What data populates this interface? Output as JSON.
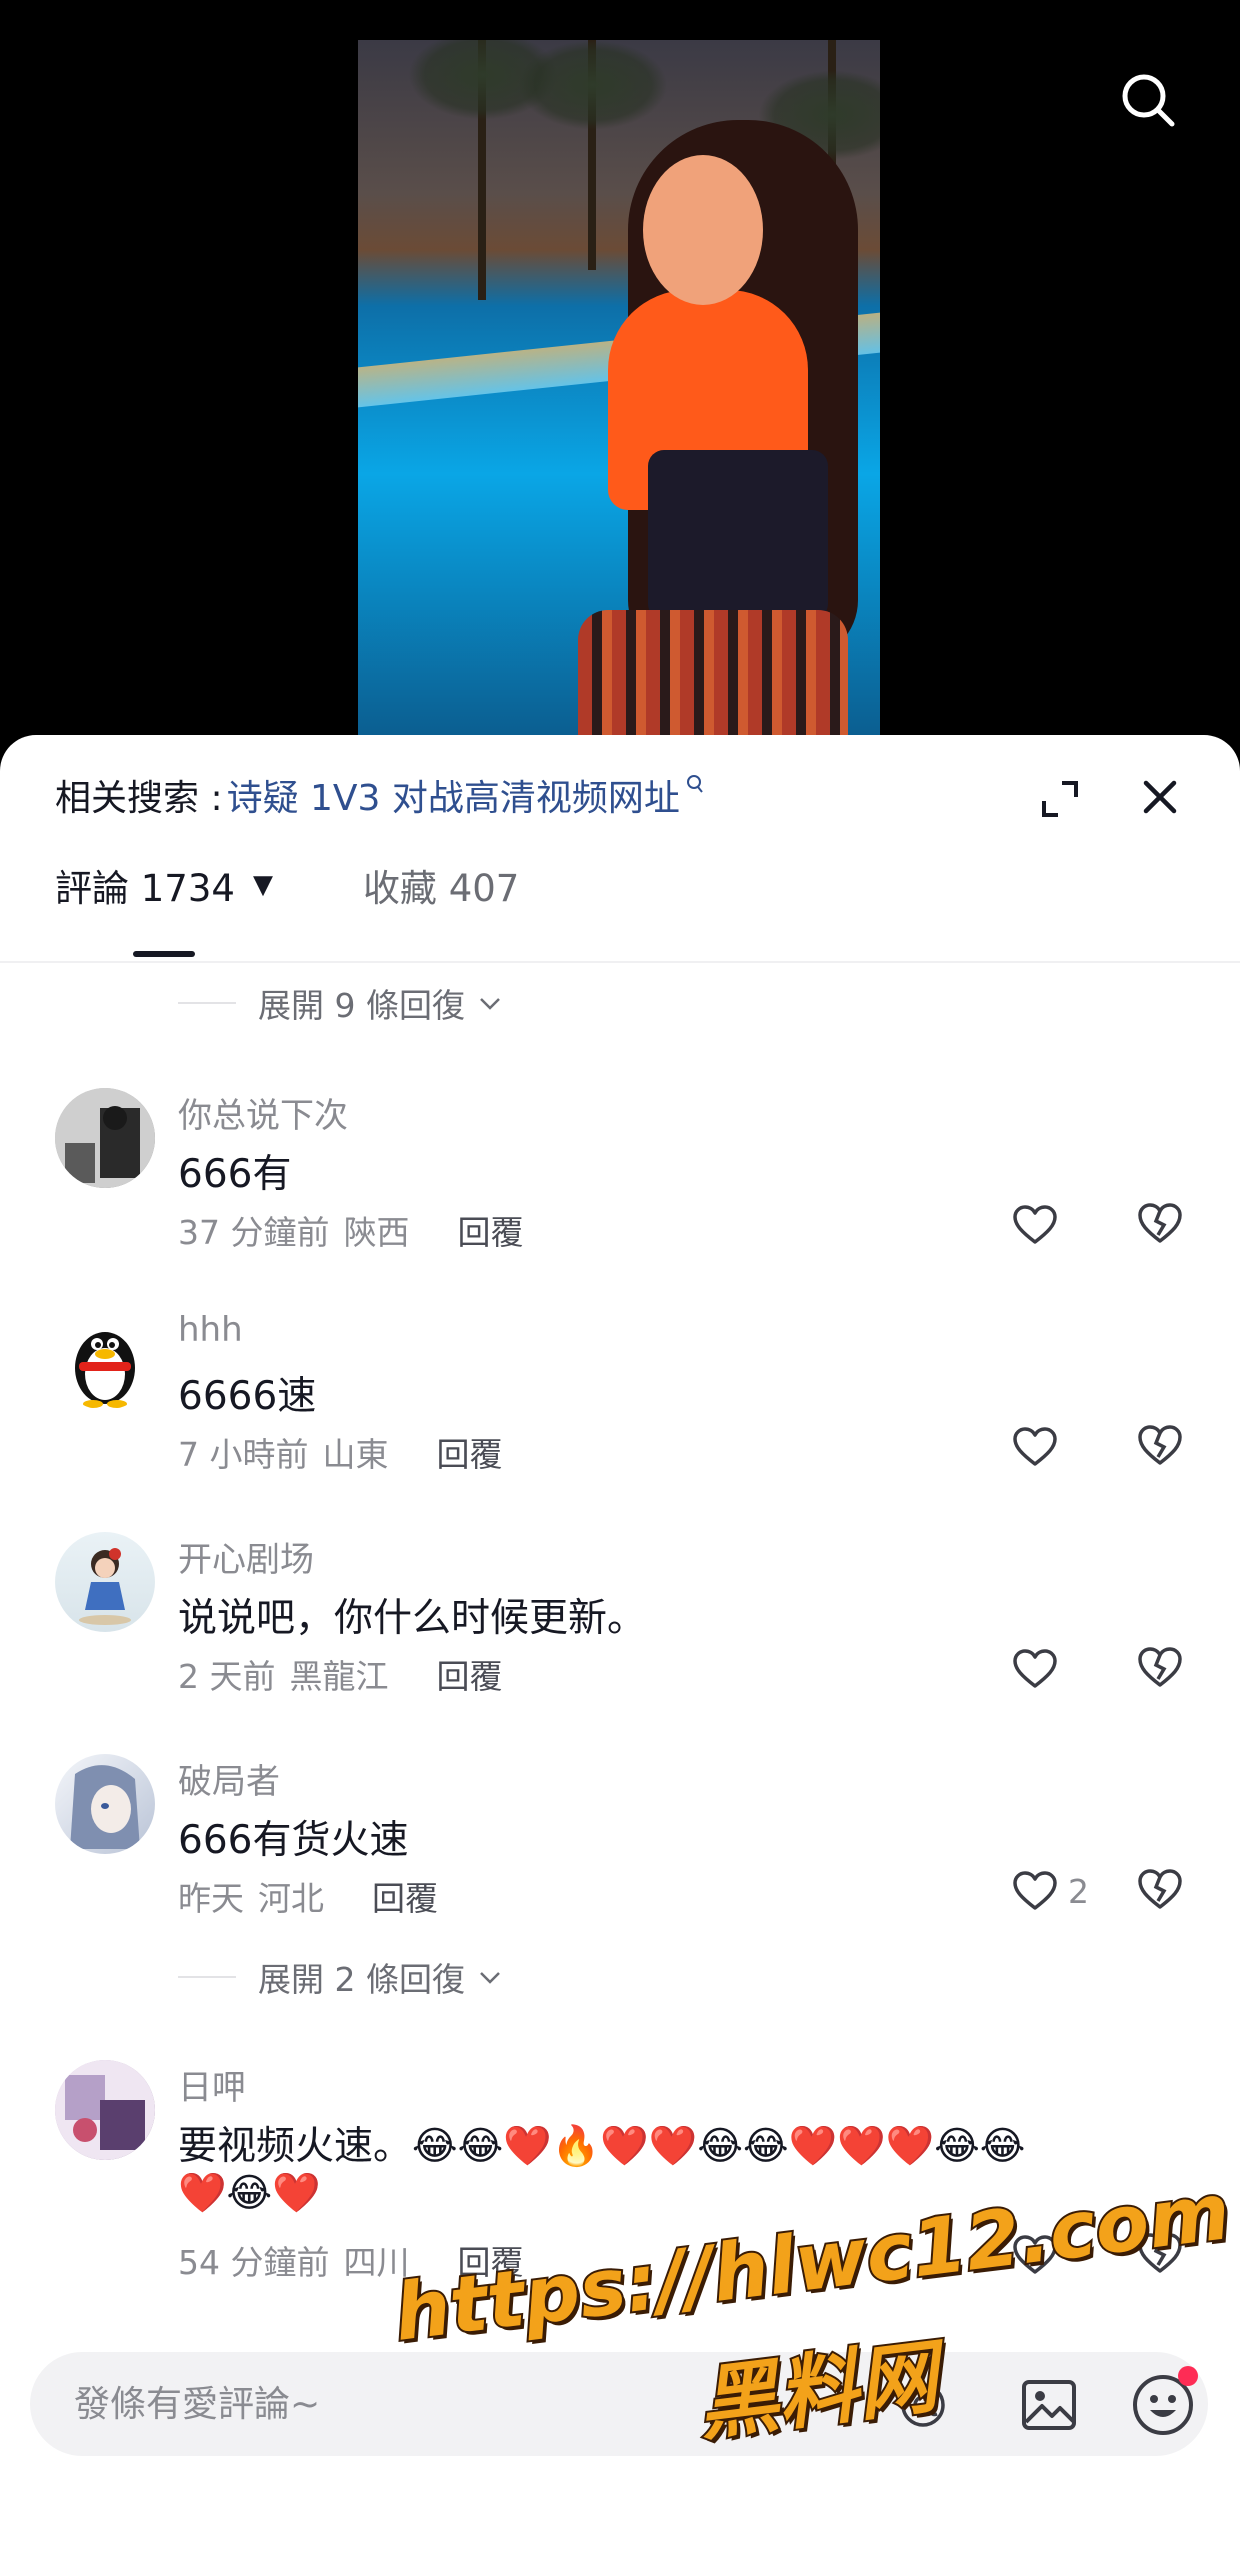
{
  "related_search": {
    "label": "相关搜索 :",
    "query": "诗疑 1V3 对战高清视频网址"
  },
  "tabs": {
    "comments_label": "評論 1734",
    "favorites_label": "收藏 407"
  },
  "expand_replies": [
    "展開 9 條回復",
    "展開 2 條回復"
  ],
  "comments": [
    {
      "user": "你总说下次",
      "text": "666有",
      "time": "37 分鐘前",
      "location": "陝西",
      "reply": "回覆",
      "likes": ""
    },
    {
      "user": "hhh",
      "text": "6666速",
      "time": "7 小時前",
      "location": "山東",
      "reply": "回覆",
      "likes": ""
    },
    {
      "user": "开心剧场",
      "text": "说说吧，你什么时候更新。",
      "time": "2 天前",
      "location": "黑龍江",
      "reply": "回覆",
      "likes": ""
    },
    {
      "user": "破局者",
      "text": "666有货火速",
      "time": "昨天",
      "location": "河北",
      "reply": "回覆",
      "likes": "2"
    },
    {
      "user": "日呷",
      "text": "要视频火速。😂😂❤️🔥❤️❤️😂😂❤️❤️❤️😂😂",
      "text2": "❤️😂❤️",
      "time": "54 分鐘前",
      "location": "四川",
      "reply": "回覆",
      "likes": ""
    }
  ],
  "input": {
    "placeholder": "發條有愛評論~"
  },
  "watermark": {
    "url": "https://hlwc12.com",
    "name": "黑料网"
  },
  "icons": {
    "search": "search-icon",
    "expand": "expand-icon",
    "close": "close-icon",
    "like": "heart-icon",
    "dislike": "broken-heart-icon",
    "mention": "at-sign-icon",
    "image": "image-icon",
    "emoji": "emoji-icon"
  },
  "colors": {
    "link_blue": "#2f4f8f",
    "notification_dot": "#fe2c55",
    "watermark_orange": "#f3a21a"
  }
}
